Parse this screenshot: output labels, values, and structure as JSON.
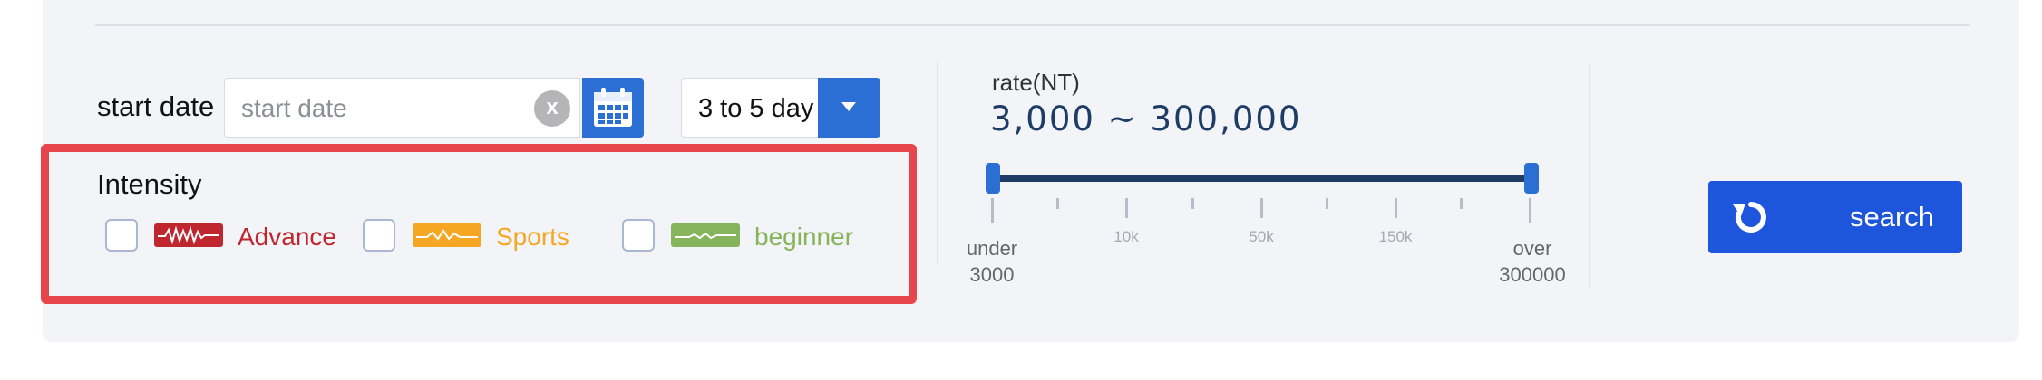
{
  "filter": {
    "start_date": {
      "label": "start date",
      "placeholder": "start date",
      "value": "",
      "clear_label": "x"
    },
    "duration": {
      "selected": "3 to 5 day"
    },
    "intensity": {
      "title": "Intensity",
      "options": [
        {
          "label": "Advance",
          "color": "#c0262d",
          "checked": false
        },
        {
          "label": "Sports",
          "color": "#f5a623",
          "checked": false
        },
        {
          "label": "beginner",
          "color": "#86b45c",
          "checked": false
        }
      ]
    },
    "rate": {
      "title": "rate(NT)",
      "range_text": "3,000 ~ 300,000",
      "min_value": 3000,
      "max_value": 300000,
      "tick_labels": [
        "10k",
        "50k",
        "150k"
      ],
      "low_end": [
        "under",
        "3000"
      ],
      "high_end": [
        "over",
        "300000"
      ],
      "track_color": "#1d3c66"
    },
    "search": {
      "label": "search",
      "color": "#1d55dc"
    }
  },
  "highlight_color": "#e8464d",
  "accent_color": "#2c6fd4"
}
